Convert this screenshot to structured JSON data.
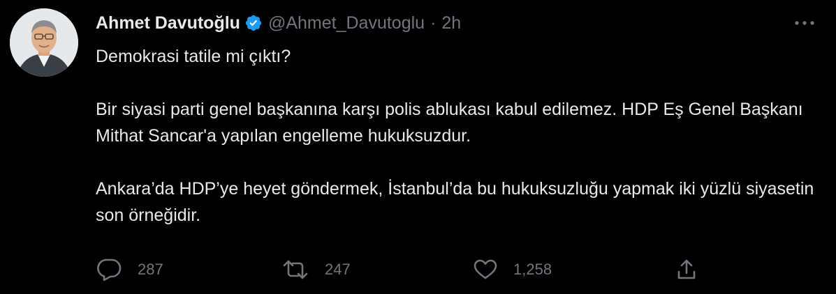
{
  "tweet": {
    "author": {
      "display_name": "Ahmet Davutoğlu",
      "handle": "@Ahmet_Davutoglu",
      "verified": true
    },
    "separator": "·",
    "time": "2h",
    "paragraphs": [
      "Demokrasi tatile mi çıktı?",
      "Bir siyasi parti genel başkanına karşı polis ablukası kabul edilemez. HDP Eş Genel Başkanı Mithat Sancar'a yapılan engelleme hukuksuzdur.",
      "Ankara’da HDP’ye heyet göndermek, İstanbul’da bu hukuksuzluğu yapmak iki yüzlü siyasetin son örneğidir."
    ],
    "stats": {
      "replies": "287",
      "retweets": "247",
      "likes": "1,258"
    }
  },
  "icons": {
    "verified": "verified-badge-icon",
    "more": "more-dots-icon",
    "reply": "reply-bubble-icon",
    "retweet": "retweet-icon",
    "like": "heart-icon",
    "share": "share-upload-icon"
  },
  "colors": {
    "background": "#000000",
    "text": "#e7e9ea",
    "secondary": "#71767b",
    "verified": "#1d9bf0"
  }
}
